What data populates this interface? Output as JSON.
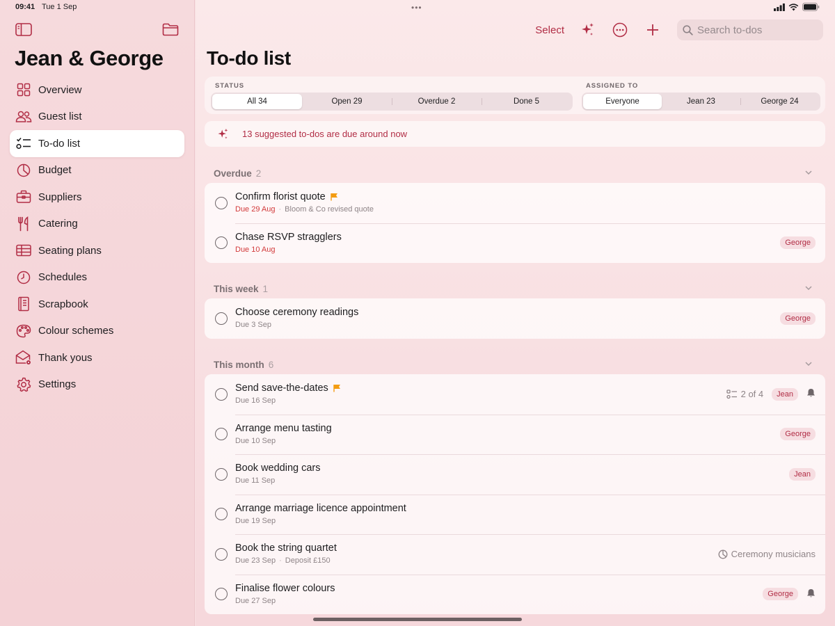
{
  "status": {
    "time": "09:41",
    "date": "Tue 1 Sep"
  },
  "sidebar": {
    "title": "Jean & George",
    "items": [
      {
        "label": "Overview",
        "icon": "grid-icon"
      },
      {
        "label": "Guest list",
        "icon": "people-icon"
      },
      {
        "label": "To-do list",
        "icon": "checklist-icon",
        "active": true
      },
      {
        "label": "Budget",
        "icon": "pie-chart-icon"
      },
      {
        "label": "Suppliers",
        "icon": "briefcase-icon"
      },
      {
        "label": "Catering",
        "icon": "fork-knife-icon"
      },
      {
        "label": "Seating plans",
        "icon": "table-icon"
      },
      {
        "label": "Schedules",
        "icon": "clock-icon"
      },
      {
        "label": "Scrapbook",
        "icon": "book-icon"
      },
      {
        "label": "Colour schemes",
        "icon": "palette-icon"
      },
      {
        "label": "Thank yous",
        "icon": "envelope-icon"
      },
      {
        "label": "Settings",
        "icon": "gear-icon"
      }
    ]
  },
  "toolbar": {
    "select_label": "Select",
    "search_placeholder": "Search to-dos"
  },
  "page": {
    "title": "To-do list"
  },
  "filters": {
    "status_label": "STATUS",
    "status_options": [
      "All 34",
      "Open 29",
      "Overdue 2",
      "Done 5"
    ],
    "status_selected": "All 34",
    "assigned_label": "ASSIGNED TO",
    "assigned_options": [
      "Everyone",
      "Jean 23",
      "George 24"
    ],
    "assigned_selected": "Everyone"
  },
  "suggestion": {
    "text": "13 suggested to-dos are due around now"
  },
  "sections": [
    {
      "name": "Overdue",
      "count": "2",
      "items": [
        {
          "title": "Confirm florist quote",
          "flag": true,
          "due": "Due 29 Aug",
          "overdue": true,
          "note": "Bloom & Co revised quote"
        },
        {
          "title": "Chase RSVP stragglers",
          "due": "Due 10 Aug",
          "overdue": true,
          "assignee": "George"
        }
      ]
    },
    {
      "name": "This week",
      "count": "1",
      "items": [
        {
          "title": "Choose ceremony readings",
          "due": "Due 3 Sep",
          "assignee": "George"
        }
      ]
    },
    {
      "name": "This month",
      "count": "6",
      "items": [
        {
          "title": "Send save-the-dates",
          "flag": true,
          "due": "Due 16 Sep",
          "subtasks": "2 of 4",
          "assignee": "Jean",
          "reminder": true
        },
        {
          "title": "Arrange menu tasting",
          "due": "Due 10 Sep",
          "assignee": "George"
        },
        {
          "title": "Book wedding cars",
          "due": "Due 11 Sep",
          "assignee": "Jean"
        },
        {
          "title": "Arrange marriage licence appointment",
          "due": "Due 19 Sep"
        },
        {
          "title": "Book the string quartet",
          "due": "Due 23 Sep",
          "note": "Deposit £150",
          "category": "Ceremony musicians"
        },
        {
          "title": "Finalise flower colours",
          "due": "Due 27 Sep",
          "assignee": "George",
          "reminder": true
        }
      ]
    }
  ],
  "colors": {
    "accent": "#b12d45",
    "overdue": "#d23a3a",
    "flag": "#f39c12"
  }
}
